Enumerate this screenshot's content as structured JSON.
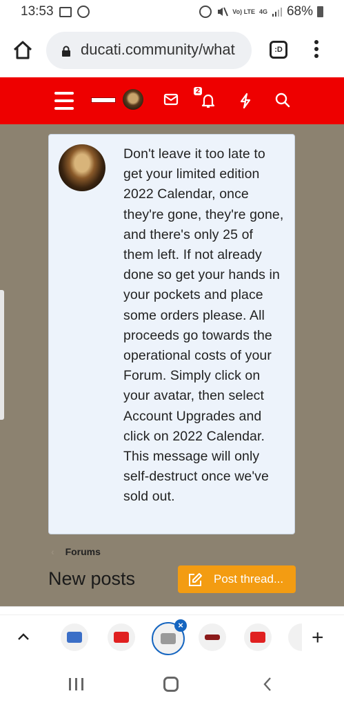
{
  "status_bar": {
    "time": "13:53",
    "network_label": "Vo) LTE",
    "network_type": "4G",
    "battery": "68%"
  },
  "browser": {
    "url": "ducati.community/what",
    "tab_switcher_label": ":D"
  },
  "header": {
    "notification_count": "2"
  },
  "notice": {
    "text": "Don't leave it too late to get your limited edition 2022 Calendar, once they're gone, they're gone, and there's only 25 of them left. If not already done so get your hands in your pockets and place some orders please. All proceeds go towards the operational costs of your Forum. Simply click on your avatar, then select Account Upgrades and click on 2022 Calendar. This message will only self-destruct once we've sold out."
  },
  "breadcrumb": {
    "label": "Forums"
  },
  "page_title": "New posts",
  "post_button_label": "Post thread...",
  "colors": {
    "site_header": "#ee0000",
    "page_background": "#8c8270",
    "notice_background": "#edf3fb",
    "post_button": "#f39c12",
    "active_tab_ring": "#1565c0"
  },
  "icons": {
    "status_left": [
      "gmail-icon",
      "whatsapp-icon"
    ],
    "status_right": [
      "alarm-icon",
      "mute-icon",
      "signal-icon",
      "battery-icon"
    ],
    "browser": [
      "home-icon",
      "lock-icon",
      "tabs-icon",
      "overflow-menu-icon"
    ],
    "header": [
      "hamburger-icon",
      "envelope-icon",
      "bell-icon",
      "bolt-icon",
      "search-icon"
    ],
    "tab_strip": [
      "chevron-up-icon",
      "plus-icon"
    ],
    "nav": [
      "recent-apps-icon",
      "home-icon",
      "back-icon"
    ]
  }
}
